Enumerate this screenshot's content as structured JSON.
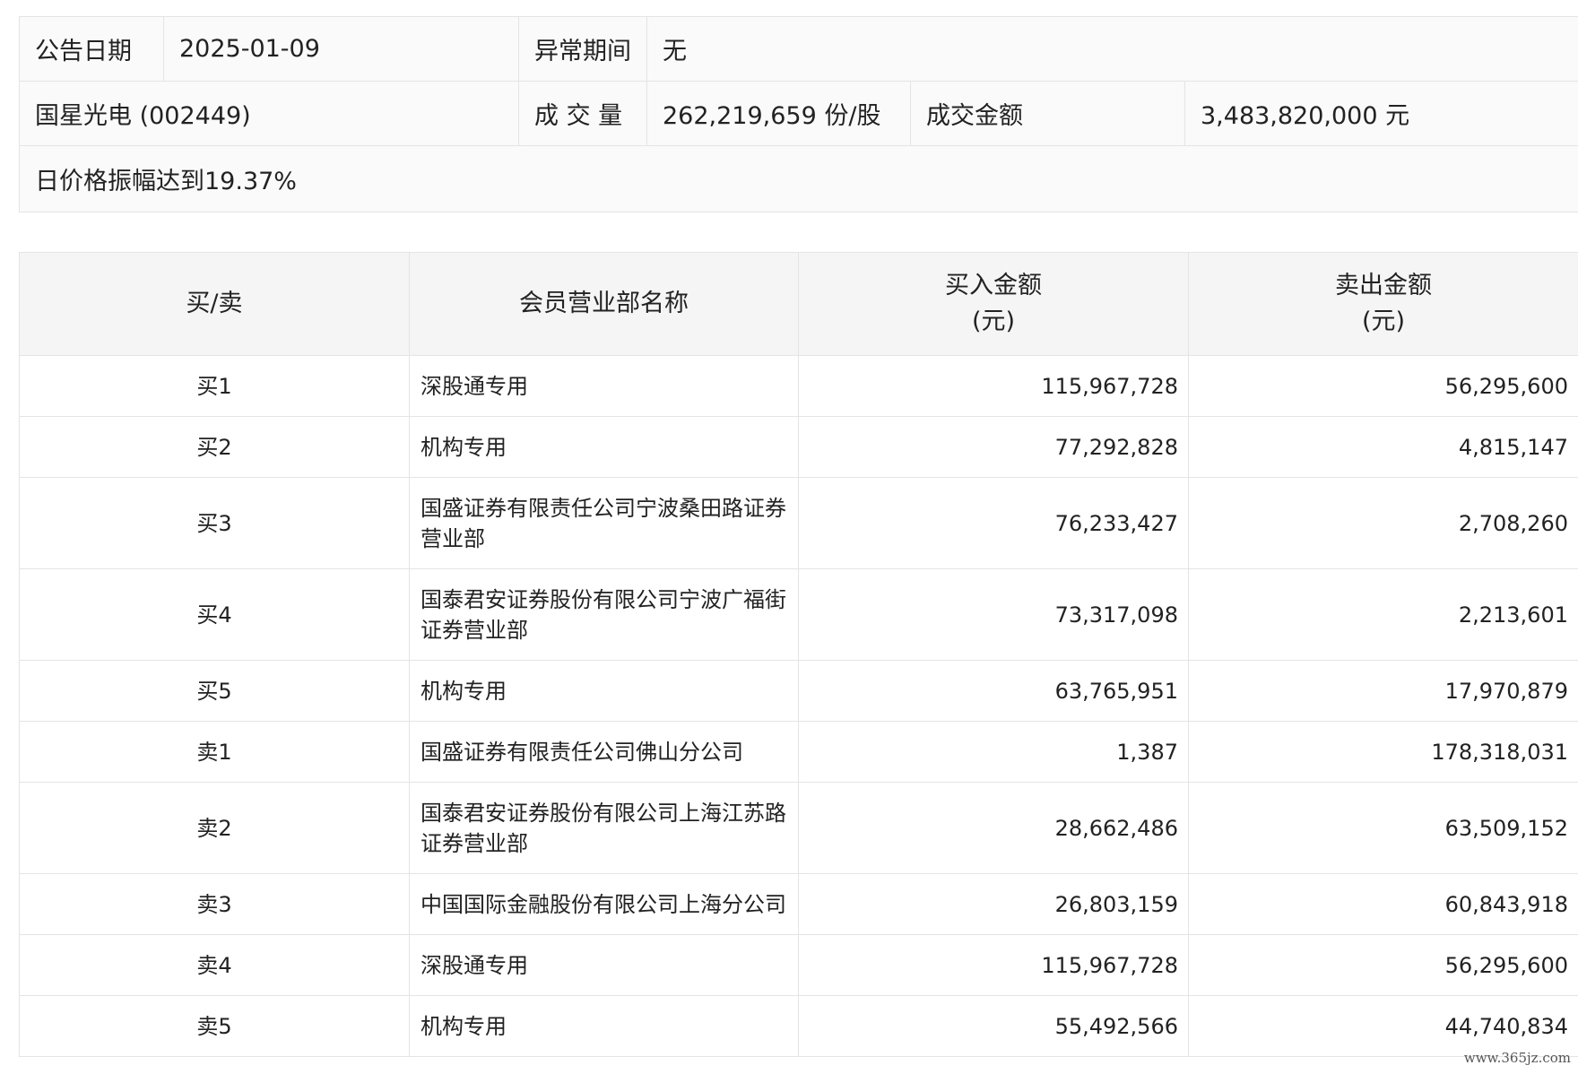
{
  "info": {
    "date_label": "公告日期",
    "date_value": "2025-01-09",
    "abnormal_label": "异常期间",
    "abnormal_value": "无",
    "stock_name": "国星光电 (002449)",
    "volume_label": "成 交 量",
    "volume_value": "262,219,659 份/股",
    "amount_label": "成交金额",
    "amount_value": "3,483,820,000 元",
    "reason": "日价格振幅达到19.37%"
  },
  "table": {
    "headers": {
      "side": "买/卖",
      "name": "会员营业部名称",
      "buy_line1": "买入金额",
      "buy_line2": "(元)",
      "sell_line1": "卖出金额",
      "sell_line2": "(元)"
    },
    "rows": [
      {
        "side": "买1",
        "name": "深股通专用",
        "buy": "115,967,728",
        "sell": "56,295,600"
      },
      {
        "side": "买2",
        "name": "机构专用",
        "buy": "77,292,828",
        "sell": "4,815,147"
      },
      {
        "side": "买3",
        "name": "国盛证券有限责任公司宁波桑田路证券营业部",
        "buy": "76,233,427",
        "sell": "2,708,260"
      },
      {
        "side": "买4",
        "name": "国泰君安证券股份有限公司宁波广福街证券营业部",
        "buy": "73,317,098",
        "sell": "2,213,601"
      },
      {
        "side": "买5",
        "name": "机构专用",
        "buy": "63,765,951",
        "sell": "17,970,879"
      },
      {
        "side": "卖1",
        "name": "国盛证券有限责任公司佛山分公司",
        "buy": "1,387",
        "sell": "178,318,031"
      },
      {
        "side": "卖2",
        "name": "国泰君安证券股份有限公司上海江苏路证券营业部",
        "buy": "28,662,486",
        "sell": "63,509,152"
      },
      {
        "side": "卖3",
        "name": "中国国际金融股份有限公司上海分公司",
        "buy": "26,803,159",
        "sell": "60,843,918"
      },
      {
        "side": "卖4",
        "name": "深股通专用",
        "buy": "115,967,728",
        "sell": "56,295,600"
      },
      {
        "side": "卖5",
        "name": "机构专用",
        "buy": "55,492,566",
        "sell": "44,740,834"
      }
    ]
  },
  "watermark": "www.365jz.com"
}
